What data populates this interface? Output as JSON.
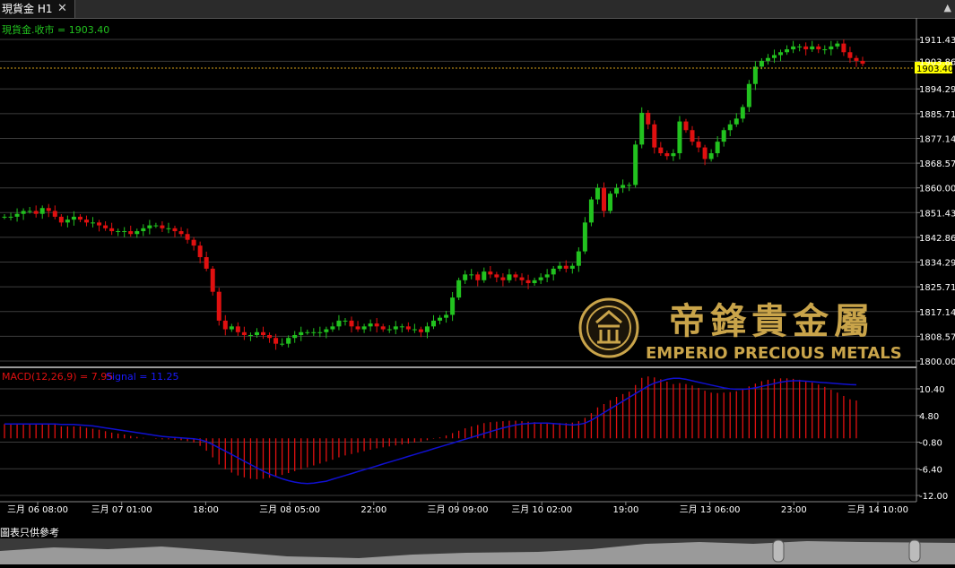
{
  "tab": {
    "title": "現貨金 H1",
    "close_glyph": "✕"
  },
  "corner_glyph": "▲",
  "price_label": "現貨金.收市 = 1903.40",
  "current_price": "1903.40",
  "macd_label": "MACD(12,26,9) = 7.95",
  "signal_label": "Signal = 11.25",
  "price_ticks": [
    "1911.43",
    "1903.86",
    "1894.29",
    "1885.71",
    "1877.14",
    "1868.57",
    "1860.00",
    "1851.43",
    "1842.86",
    "1834.29",
    "1825.71",
    "1817.14",
    "1808.57",
    "1800.00"
  ],
  "macd_ticks": [
    "10.40",
    "4.80",
    "-0.80",
    "-6.40",
    "-12.00"
  ],
  "time_labels": [
    "三月 06 08:00",
    "三月 07 01:00",
    "18:00",
    "三月 08 05:00",
    "22:00",
    "三月 09 09:00",
    "三月 10 02:00",
    "19:00",
    "三月 13 06:00",
    "23:00",
    "三月 14 10:00"
  ],
  "watermark": {
    "chinese": "帝鋒貴金屬",
    "english": "EMPERIO PRECIOUS METALS"
  },
  "note": "圖表只供參考",
  "colors": {
    "up": "#22c21f",
    "down": "#e01010",
    "grid": "#3c3c3c",
    "axis_text": "#ffffff",
    "signal": "#1010d0",
    "gold": "#c9a44a",
    "price_line": "#d4a017"
  },
  "chart_data": {
    "type": "candlestick",
    "price_ylim": [
      1800.0,
      1911.43
    ],
    "macd_ylim": [
      -12.0,
      10.4
    ],
    "close_series": [
      1850,
      1850,
      1851,
      1852,
      1852,
      1851,
      1853,
      1852,
      1850,
      1848,
      1849,
      1850,
      1849,
      1848,
      1848,
      1847,
      1846,
      1845,
      1845,
      1845,
      1844,
      1845,
      1846,
      1847,
      1847,
      1846,
      1846,
      1845,
      1844,
      1842,
      1840,
      1836,
      1832,
      1824,
      1814,
      1811,
      1812,
      1810,
      1809,
      1809,
      1810,
      1809,
      1808,
      1806,
      1806,
      1808,
      1809,
      1810,
      1810,
      1810,
      1810,
      1811,
      1812,
      1814,
      1814,
      1812,
      1811,
      1812,
      1813,
      1812,
      1811,
      1811,
      1812,
      1812,
      1811,
      1811,
      1810,
      1812,
      1814,
      1815,
      1816,
      1822,
      1828,
      1830,
      1830,
      1828,
      1831,
      1830,
      1829,
      1828,
      1830,
      1829,
      1828,
      1827,
      1828,
      1829,
      1830,
      1832,
      1833,
      1832,
      1833,
      1838,
      1848,
      1856,
      1860,
      1852,
      1858,
      1860,
      1861,
      1861,
      1875,
      1886,
      1882,
      1874,
      1872,
      1871,
      1872,
      1883,
      1880,
      1876,
      1874,
      1870,
      1872,
      1876,
      1880,
      1882,
      1884,
      1888,
      1896,
      1902,
      1904,
      1905,
      1906,
      1907,
      1908,
      1909,
      1909,
      1908,
      1909,
      1908,
      1908,
      1909,
      1910,
      1907,
      1905,
      1904,
      1903
    ],
    "macd_hist": [
      3,
      3,
      3,
      3,
      3,
      3,
      3,
      3,
      3,
      2.5,
      2.5,
      2.5,
      2.5,
      2.2,
      2.0,
      1.8,
      1.5,
      1.2,
      1.0,
      0.8,
      0.5,
      0.3,
      0.1,
      0,
      -0.1,
      -0.2,
      -0.2,
      -0.3,
      -0.4,
      -0.6,
      -0.9,
      -1.6,
      -2.6,
      -4,
      -5.5,
      -6.5,
      -7.2,
      -7.8,
      -8.2,
      -8.5,
      -8.6,
      -8.5,
      -8.3,
      -8.0,
      -7.7,
      -7.3,
      -6.9,
      -6.5,
      -6.1,
      -5.7,
      -5.3,
      -4.9,
      -4.5,
      -4.0,
      -3.6,
      -3.3,
      -3.0,
      -2.7,
      -2.4,
      -2.1,
      -1.9,
      -1.7,
      -1.5,
      -1.3,
      -1.1,
      -0.9,
      -0.7,
      -0.4,
      -0.1,
      0.2,
      0.6,
      1.1,
      1.6,
      2.1,
      2.5,
      2.8,
      3.2,
      3.4,
      3.5,
      3.6,
      3.7,
      3.7,
      3.6,
      3.5,
      3.4,
      3.3,
      3.2,
      3.2,
      3.2,
      3.2,
      3.3,
      3.6,
      4.3,
      5.3,
      6.5,
      7.2,
      8.0,
      8.7,
      9.3,
      9.8,
      11.2,
      12.7,
      13.0,
      12.8,
      12.4,
      11.9,
      11.4,
      11.6,
      11.4,
      11.1,
      10.6,
      10.0,
      9.6,
      9.5,
      9.6,
      9.7,
      9.9,
      10.2,
      10.9,
      11.5,
      12.0,
      12.3,
      12.5,
      12.6,
      12.6,
      12.5,
      12.3,
      12.0,
      11.7,
      11.3,
      10.8,
      10.2,
      9.6,
      8.9,
      8.2,
      7.95
    ],
    "signal": [
      3,
      3,
      3,
      3,
      3,
      3,
      3,
      3,
      3,
      2.9,
      2.9,
      2.9,
      2.8,
      2.7,
      2.6,
      2.4,
      2.2,
      2.0,
      1.8,
      1.6,
      1.4,
      1.2,
      1.0,
      0.8,
      0.6,
      0.4,
      0.3,
      0.2,
      0.1,
      0,
      -0.1,
      -0.3,
      -0.7,
      -1.3,
      -2.0,
      -2.7,
      -3.4,
      -4.1,
      -4.8,
      -5.5,
      -6.2,
      -6.9,
      -7.5,
      -8.0,
      -8.5,
      -8.9,
      -9.2,
      -9.4,
      -9.5,
      -9.4,
      -9.2,
      -9.0,
      -8.6,
      -8.2,
      -7.8,
      -7.4,
      -7.0,
      -6.6,
      -6.2,
      -5.8,
      -5.4,
      -5.0,
      -4.6,
      -4.2,
      -3.8,
      -3.4,
      -3.0,
      -2.6,
      -2.2,
      -1.8,
      -1.4,
      -1.0,
      -0.6,
      -0.2,
      0.2,
      0.6,
      1.0,
      1.4,
      1.8,
      2.2,
      2.5,
      2.8,
      3.0,
      3.1,
      3.2,
      3.2,
      3.2,
      3.1,
      3.0,
      2.9,
      2.8,
      2.9,
      3.2,
      3.8,
      4.6,
      5.4,
      6.2,
      7.0,
      7.8,
      8.6,
      9.4,
      10.2,
      11.0,
      11.6,
      12.0,
      12.4,
      12.6,
      12.6,
      12.4,
      12.1,
      11.8,
      11.5,
      11.2,
      10.9,
      10.6,
      10.4,
      10.3,
      10.3,
      10.4,
      10.6,
      10.9,
      11.2,
      11.5,
      11.8,
      12.0,
      12.1,
      12.1,
      12.0,
      11.9,
      11.8,
      11.7,
      11.6,
      11.5,
      11.4,
      11.3,
      11.25
    ]
  }
}
